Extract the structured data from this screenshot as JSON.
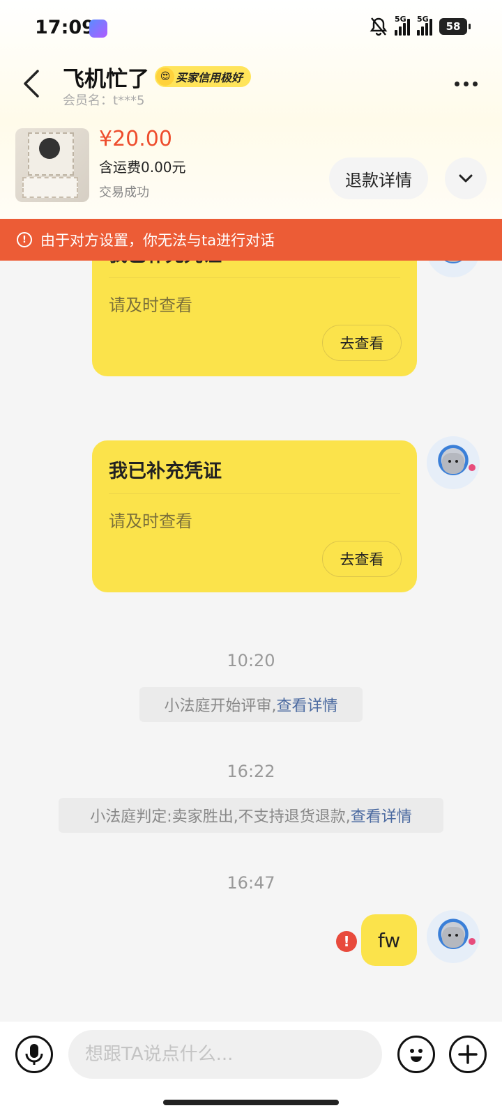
{
  "status_bar": {
    "time": "17:09",
    "network_1": "5G",
    "network_2": "5G",
    "battery": "58"
  },
  "header": {
    "back_icon": "chevron-left-icon",
    "name": "飞机忙了",
    "credit_badge": "买家信用极好",
    "member": "会员名：t***5",
    "more_icon": "more-dots-icon"
  },
  "order": {
    "price": "¥20.00",
    "shipping": "含运费0.00元",
    "status": "交易成功",
    "refund_button": "退款详情",
    "expand_icon": "chevron-down-icon"
  },
  "alert": {
    "text": "由于对方设置，你无法与ta进行对话",
    "icon": "alert-circle-icon",
    "color": "#ec5c36"
  },
  "messages": {
    "card1": {
      "title": "我已补充凭证",
      "subtitle": "请及时查看",
      "button": "去查看"
    },
    "card2": {
      "title": "我已补充凭证",
      "subtitle": "请及时查看",
      "button": "去查看"
    },
    "time1": "10:20",
    "system1": {
      "text": "小法庭开始评审,",
      "link": "查看详情"
    },
    "time2": "16:22",
    "system2": {
      "text": "小法庭判定:卖家胜出,不支持退货退款,",
      "link": "查看详情"
    },
    "time3": "16:47",
    "text_message": "fw",
    "error_mark": "!"
  },
  "input_bar": {
    "placeholder": "想跟TA说点什么...",
    "voice_icon": "microphone-icon",
    "emoji_icon": "emoji-icon",
    "plus_icon": "plus-icon"
  },
  "colors": {
    "bubble": "#fbe34b",
    "price": "#ee4d2d",
    "link": "#4b6aa0"
  }
}
